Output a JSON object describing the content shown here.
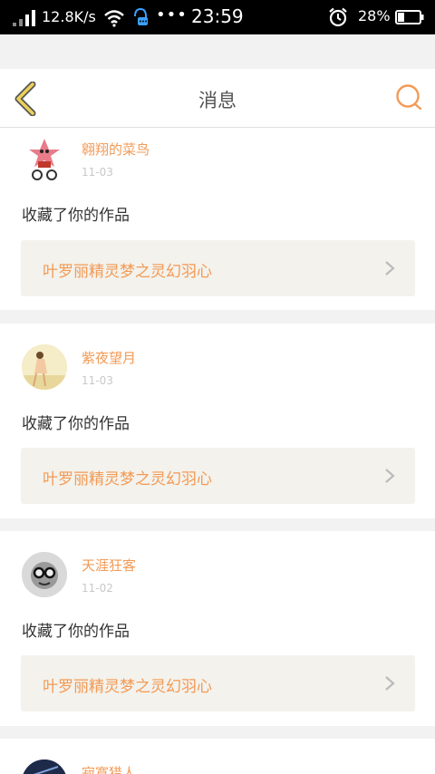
{
  "status_bar": {
    "net_speed": "12.8K/s",
    "dots": "•••",
    "time": "23:59",
    "battery_percent": "28%",
    "icons": [
      "signal-icon",
      "wifi-icon",
      "app-notification-icon",
      "alarm-icon",
      "battery-icon"
    ]
  },
  "header": {
    "title": "消息",
    "back_icon": "chevron-left-icon",
    "search_icon": "search-icon"
  },
  "colors": {
    "accent": "#f39a55",
    "back_icon": "#ebd15a",
    "work_box_bg": "#f3f2ec"
  },
  "messages": [
    {
      "username": "翱翔的菜鸟",
      "date": "11-03",
      "action": "收藏了你的作品",
      "work_title": "叶罗丽精灵梦之灵幻羽心"
    },
    {
      "username": "紫夜望月",
      "date": "11-03",
      "action": "收藏了你的作品",
      "work_title": "叶罗丽精灵梦之灵幻羽心"
    },
    {
      "username": "天涯狂客",
      "date": "11-02",
      "action": "收藏了你的作品",
      "work_title": "叶罗丽精灵梦之灵幻羽心"
    },
    {
      "username": "寂寞猎人"
    }
  ]
}
